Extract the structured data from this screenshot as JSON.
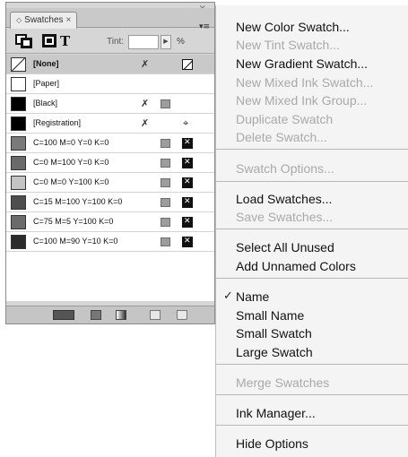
{
  "panel": {
    "tab_label": "Swatches",
    "tab_close": "×",
    "window_controls": "– ×",
    "tint_label": "Tint:",
    "tint_value": "",
    "tint_unit": "%",
    "text_glyph": "T",
    "menu_button": "▾≡",
    "swatches": [
      {
        "name": "[None]",
        "selected": true,
        "color": "#ffffff"
      },
      {
        "name": "[Paper]",
        "color": "#ffffff"
      },
      {
        "name": "[Black]",
        "color": "#000000"
      },
      {
        "name": "[Registration]",
        "color": "#000000"
      },
      {
        "name": "C=100 M=0 Y=0 K=0",
        "color": "#7a7a7a"
      },
      {
        "name": "C=0 M=100 Y=0 K=0",
        "color": "#6a6a6a"
      },
      {
        "name": "C=0 M=0 Y=100 K=0",
        "color": "#c4c4c4"
      },
      {
        "name": "C=15 M=100 Y=100 K=0",
        "color": "#4e4e4e"
      },
      {
        "name": "C=75 M=5 Y=100 K=0",
        "color": "#6b6b6b"
      },
      {
        "name": "C=100 M=90 Y=10 K=0",
        "color": "#2a2a2a"
      }
    ]
  },
  "menu": {
    "items": [
      {
        "label": "New Color Swatch...",
        "enabled": true
      },
      {
        "label": "New Tint Swatch...",
        "enabled": false
      },
      {
        "label": "New Gradient Swatch...",
        "enabled": true
      },
      {
        "label": "New Mixed Ink Swatch...",
        "enabled": false
      },
      {
        "label": "New Mixed Ink Group...",
        "enabled": false
      },
      {
        "label": "Duplicate Swatch",
        "enabled": false
      },
      {
        "label": "Delete Swatch...",
        "enabled": false
      },
      {
        "label": "Swatch Options...",
        "enabled": false
      },
      {
        "label": "Load Swatches...",
        "enabled": true
      },
      {
        "label": "Save Swatches...",
        "enabled": false
      },
      {
        "label": "Select All Unused",
        "enabled": true
      },
      {
        "label": "Add Unnamed Colors",
        "enabled": true
      },
      {
        "label": "Name",
        "enabled": true,
        "checked": true
      },
      {
        "label": "Small Name",
        "enabled": true
      },
      {
        "label": "Small Swatch",
        "enabled": true
      },
      {
        "label": "Large Swatch",
        "enabled": true
      },
      {
        "label": "Merge Swatches",
        "enabled": false
      },
      {
        "label": "Ink Manager...",
        "enabled": true
      },
      {
        "label": "Hide Options",
        "enabled": true
      }
    ],
    "check_mark": "✓"
  }
}
